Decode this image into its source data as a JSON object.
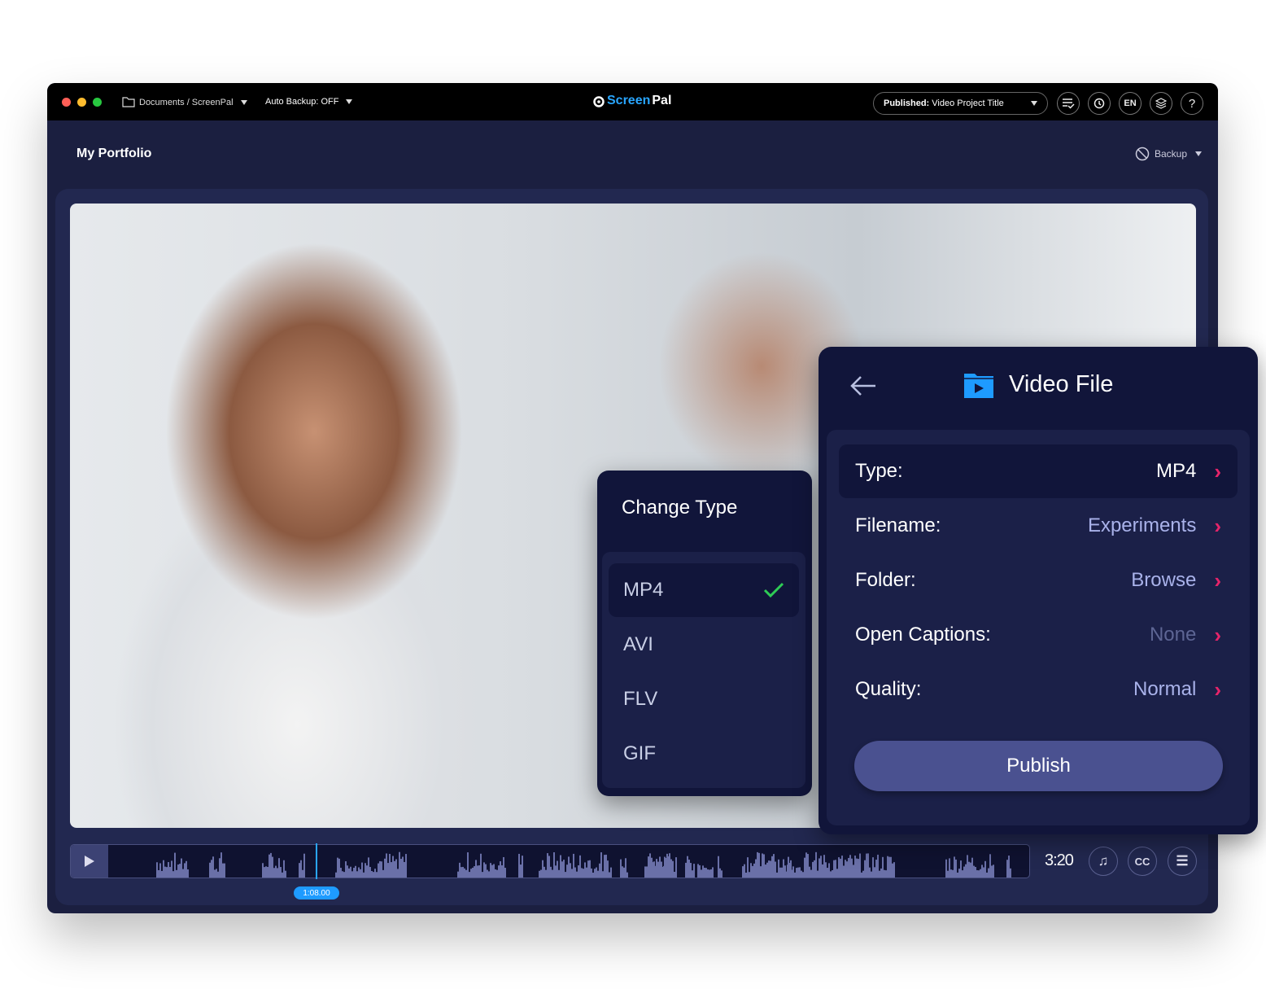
{
  "titlebar": {
    "breadcrumb": "Documents / ScreenPal",
    "auto_backup": "Auto Backup: OFF",
    "logo_screen": "Screen",
    "logo_pal": "Pal",
    "published_label": "Published:",
    "project_title": "Video Project Title",
    "icons": [
      "checklist-icon",
      "history-icon",
      "language-icon",
      "layers-icon",
      "help-icon"
    ],
    "language": "EN",
    "help": "?"
  },
  "header": {
    "title": "My Portfolio",
    "backup_label": "Backup"
  },
  "timeline": {
    "current_time": "1:08.00",
    "duration": "3:20",
    "cc_label": "CC"
  },
  "video_file": {
    "title": "Video File",
    "rows": [
      {
        "label": "Type:",
        "value": "MP4"
      },
      {
        "label": "Filename:",
        "value": "Experiments"
      },
      {
        "label": "Folder:",
        "value": "Browse"
      },
      {
        "label": "Open Captions:",
        "value": "None"
      },
      {
        "label": "Quality:",
        "value": "Normal"
      }
    ],
    "publish_label": "Publish"
  },
  "change_type": {
    "title": "Change Type",
    "options": [
      "MP4",
      "AVI",
      "FLV",
      "GIF"
    ],
    "selected": "MP4"
  },
  "colors": {
    "accent": "#1e9bff",
    "chevron": "#e6246a",
    "check": "#2ecc55",
    "panel": "#11153a"
  }
}
